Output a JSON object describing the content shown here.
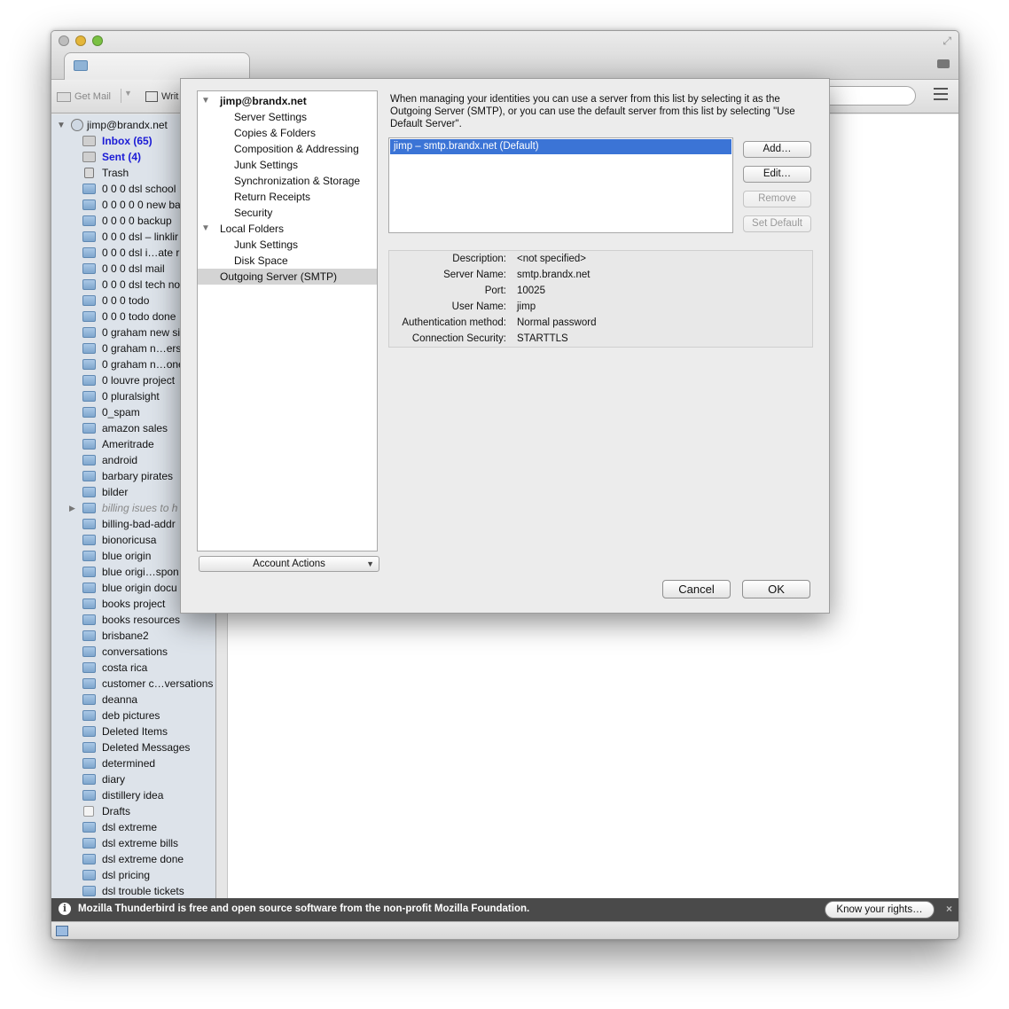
{
  "toolbar": {
    "get_mail": "Get Mail",
    "write": "Writ"
  },
  "sidebar": {
    "account": "jimp@brandx.net",
    "folders": [
      {
        "label": "Inbox (65)",
        "style": "bold",
        "icon": "inbox-icon"
      },
      {
        "label": "Sent (4)",
        "style": "bold",
        "icon": "sent-icon"
      },
      {
        "label": "Trash",
        "style": "normal",
        "icon": "trash-icon"
      },
      {
        "label": "0 0 0  dsl school",
        "style": "normal",
        "icon": "folder-icon"
      },
      {
        "label": "0 0 0 0 0 new ba",
        "style": "normal",
        "icon": "folder-icon"
      },
      {
        "label": "0 0 0 0 backup",
        "style": "normal",
        "icon": "folder-icon"
      },
      {
        "label": "0 0 0 dsl – linklir",
        "style": "normal",
        "icon": "folder-icon"
      },
      {
        "label": "0 0 0 dsl i…ate r",
        "style": "normal",
        "icon": "folder-icon"
      },
      {
        "label": "0 0 0 dsl mail",
        "style": "normal",
        "icon": "folder-icon"
      },
      {
        "label": "0 0 0 dsl tech no",
        "style": "normal",
        "icon": "folder-icon"
      },
      {
        "label": "0 0 0 todo",
        "style": "normal",
        "icon": "folder-icon"
      },
      {
        "label": "0 0 0 todo done",
        "style": "normal",
        "icon": "folder-icon"
      },
      {
        "label": "0 graham new si",
        "style": "normal",
        "icon": "folder-icon"
      },
      {
        "label": "0 graham n…ers",
        "style": "normal",
        "icon": "folder-icon"
      },
      {
        "label": "0 graham n…one",
        "style": "normal",
        "icon": "folder-icon"
      },
      {
        "label": "0 louvre project",
        "style": "normal",
        "icon": "folder-icon"
      },
      {
        "label": "0 pluralsight",
        "style": "normal",
        "icon": "folder-icon"
      },
      {
        "label": "0_spam",
        "style": "normal",
        "icon": "folder-icon"
      },
      {
        "label": "amazon sales",
        "style": "normal",
        "icon": "folder-icon"
      },
      {
        "label": "Ameritrade",
        "style": "normal",
        "icon": "folder-icon"
      },
      {
        "label": "android",
        "style": "normal",
        "icon": "folder-icon"
      },
      {
        "label": "barbary pirates",
        "style": "normal",
        "icon": "folder-icon"
      },
      {
        "label": "bilder",
        "style": "normal",
        "icon": "folder-icon"
      },
      {
        "label": "billing isues to h",
        "style": "italic",
        "icon": "folder-icon",
        "expandable": true
      },
      {
        "label": "billing-bad-addr",
        "style": "normal",
        "icon": "folder-icon"
      },
      {
        "label": "bionoricusa",
        "style": "normal",
        "icon": "folder-icon"
      },
      {
        "label": "blue origin",
        "style": "normal",
        "icon": "folder-icon"
      },
      {
        "label": "blue origi…spon",
        "style": "normal",
        "icon": "folder-icon"
      },
      {
        "label": "blue origin docu",
        "style": "normal",
        "icon": "folder-icon"
      },
      {
        "label": "books project",
        "style": "normal",
        "icon": "folder-icon"
      },
      {
        "label": "books resources",
        "style": "normal",
        "icon": "folder-icon"
      },
      {
        "label": "brisbane2",
        "style": "normal",
        "icon": "folder-icon"
      },
      {
        "label": "conversations",
        "style": "normal",
        "icon": "folder-icon"
      },
      {
        "label": "costa rica",
        "style": "normal",
        "icon": "folder-icon"
      },
      {
        "label": "customer c…versations",
        "style": "normal",
        "icon": "folder-icon"
      },
      {
        "label": "deanna",
        "style": "normal",
        "icon": "folder-icon"
      },
      {
        "label": "deb pictures",
        "style": "normal",
        "icon": "folder-icon"
      },
      {
        "label": "Deleted Items",
        "style": "normal",
        "icon": "folder-icon"
      },
      {
        "label": "Deleted Messages",
        "style": "normal",
        "icon": "folder-icon"
      },
      {
        "label": "determined",
        "style": "normal",
        "icon": "folder-icon"
      },
      {
        "label": "diary",
        "style": "normal",
        "icon": "folder-icon"
      },
      {
        "label": "distillery idea",
        "style": "normal",
        "icon": "folder-icon"
      },
      {
        "label": "Drafts",
        "style": "normal",
        "icon": "drafts-icon"
      },
      {
        "label": "dsl extreme",
        "style": "normal",
        "icon": "folder-icon"
      },
      {
        "label": "dsl extreme bills",
        "style": "normal",
        "icon": "folder-icon"
      },
      {
        "label": "dsl extreme done",
        "style": "normal",
        "icon": "folder-icon"
      },
      {
        "label": "dsl pricing",
        "style": "normal",
        "icon": "folder-icon"
      },
      {
        "label": "dsl trouble tickets",
        "style": "normal",
        "icon": "folder-icon"
      }
    ]
  },
  "notification": {
    "message": "Mozilla Thunderbird is free and open source software from the non-profit Mozilla Foundation.",
    "button": "Know your rights…",
    "close": "×"
  },
  "dialog": {
    "tree": [
      {
        "label": "jimp@brandx.net",
        "level": 0,
        "bold": true,
        "twisty": true
      },
      {
        "label": "Server Settings",
        "level": 1
      },
      {
        "label": "Copies & Folders",
        "level": 1
      },
      {
        "label": "Composition & Addressing",
        "level": 1
      },
      {
        "label": "Junk Settings",
        "level": 1
      },
      {
        "label": "Synchronization & Storage",
        "level": 1
      },
      {
        "label": "Return Receipts",
        "level": 1
      },
      {
        "label": "Security",
        "level": 1
      },
      {
        "label": "Local Folders",
        "level": 0,
        "twisty": true
      },
      {
        "label": "Junk Settings",
        "level": 1
      },
      {
        "label": "Disk Space",
        "level": 1
      },
      {
        "label": "Outgoing Server (SMTP)",
        "level": 0,
        "selected": true
      }
    ],
    "account_actions": "Account Actions",
    "description": "When managing your identities you can use a server from this list by selecting it as the Outgoing Server (SMTP), or you can use the default server from this list by selecting \"Use Default Server\".",
    "server_entry": "jimp – smtp.brandx.net (Default)",
    "buttons": {
      "add": "Add…",
      "edit": "Edit…",
      "remove": "Remove",
      "set_default": "Set Default"
    },
    "details": [
      {
        "label": "Description:",
        "value": "<not specified>"
      },
      {
        "label": "Server Name:",
        "value": "smtp.brandx.net"
      },
      {
        "label": "Port:",
        "value": "10025"
      },
      {
        "label": "User Name:",
        "value": "jimp"
      },
      {
        "label": "Authentication method:",
        "value": "Normal password"
      },
      {
        "label": "Connection Security:",
        "value": "STARTTLS"
      }
    ],
    "cancel": "Cancel",
    "ok": "OK"
  }
}
